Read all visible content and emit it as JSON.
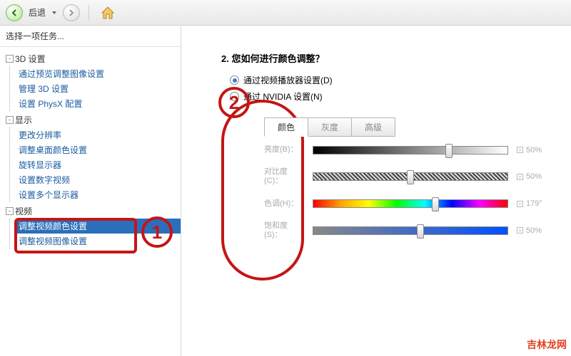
{
  "toolbar": {
    "back": "后退"
  },
  "sidebar": {
    "task_label": "选择一项任务...",
    "groups": [
      {
        "label": "3D 设置",
        "items": [
          "通过预览调整图像设置",
          "管理 3D 设置",
          "设置 PhysX 配置"
        ]
      },
      {
        "label": "显示",
        "items": [
          "更改分辨率",
          "调整桌面颜色设置",
          "旋转显示器",
          "设置数字视频",
          "设置多个显示器"
        ]
      },
      {
        "label": "视频",
        "items": [
          "调整视频颜色设置",
          "调整视频图像设置"
        ]
      }
    ],
    "selected": "调整视频颜色设置"
  },
  "content": {
    "question": "2. 您如何进行颜色调整？",
    "radios": [
      {
        "label": "通过视频播放器设置(D)",
        "checked": true
      },
      {
        "label": "通过 NVIDIA 设置(N)",
        "checked": false
      }
    ],
    "tabs": [
      "颜色",
      "灰度",
      "高级"
    ],
    "active_tab": 0,
    "sliders": [
      {
        "label": "亮度(B)：",
        "value": "50%",
        "pos": 70,
        "track": "track-brightness"
      },
      {
        "label": "对比度(C)：",
        "value": "50%",
        "pos": 50,
        "track": "track-contrast"
      },
      {
        "label": "色调(H)：",
        "value": "179°",
        "pos": 63,
        "track": "track-hue"
      },
      {
        "label": "饱和度(S)：",
        "value": "50%",
        "pos": 55,
        "track": "track-sat"
      }
    ]
  },
  "annotations": {
    "one": "1",
    "two": "2"
  },
  "watermark": "吉林龙网"
}
